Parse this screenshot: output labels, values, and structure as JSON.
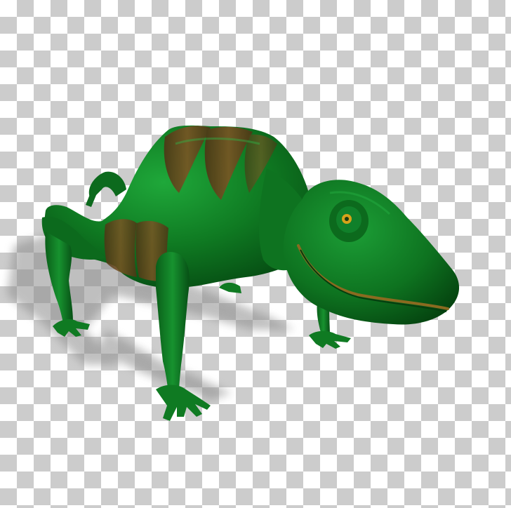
{
  "image": {
    "subject": "chameleon-3d-render",
    "background": "transparency-checkerboard",
    "colors": {
      "skin": "#0f7a22",
      "skin_dark": "#064d13",
      "skin_light": "#1fa83a",
      "stripes": "#6b4a1f",
      "eye": "#d6a21a",
      "mouth_line": "#8a6a20",
      "shadow": "#8c8c8c",
      "checker_light": "#ffffff",
      "checker_dark": "#cccccc"
    }
  }
}
